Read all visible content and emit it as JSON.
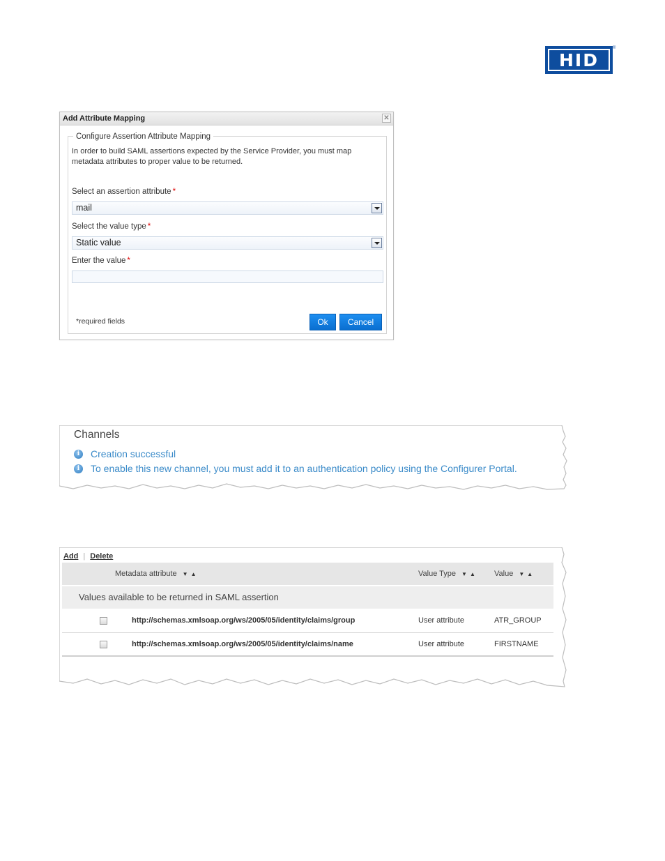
{
  "logo": {
    "text": "HID",
    "reg": "®"
  },
  "dialog": {
    "title": "Add Attribute Mapping",
    "close_icon": "close-icon",
    "legend": "Configure Assertion Attribute Mapping",
    "intro_line1": "In order to build SAML assertions expected by the Service Provider, you must map",
    "intro_line2": "metadata attributes to proper value to be returned.",
    "assertion_label": "Select an assertion attribute",
    "assertion_value": "mail",
    "value_type_label": "Select the value type",
    "value_type_value": "Static value",
    "enter_value_label": "Enter the value",
    "enter_value_value": "",
    "required_mark": "*",
    "required_note": "*required fields",
    "ok_label": "Ok",
    "cancel_label": "Cancel"
  },
  "channels": {
    "title": "Channels",
    "messages": [
      {
        "icon": "info-icon",
        "text": "Creation successful"
      },
      {
        "icon": "info-icon",
        "text": "To enable this new channel, you must add it to an authentication policy using the Configurer Portal."
      }
    ]
  },
  "mapping_table": {
    "add_label": "Add",
    "separator": "|",
    "delete_label": "Delete",
    "columns": [
      "Metadata attribute",
      "Value Type",
      "Value"
    ],
    "sort_icons": "sort-arrows-icon",
    "group_label": "Values available to be returned in SAML assertion",
    "rows": [
      {
        "attribute": "http://schemas.xmlsoap.org/ws/2005/05/identity/claims/group",
        "value_type": "User attribute",
        "value": "ATR_GROUP",
        "checked": false
      },
      {
        "attribute": "http://schemas.xmlsoap.org/ws/2005/05/identity/claims/name",
        "value_type": "User attribute",
        "value": "FIRSTNAME",
        "checked": false
      }
    ]
  }
}
